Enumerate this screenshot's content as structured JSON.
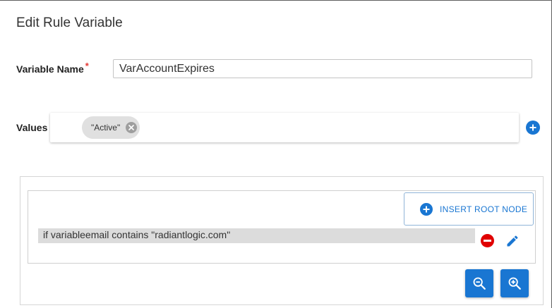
{
  "dialog": {
    "title": "Edit Rule Variable"
  },
  "variable": {
    "label": "Variable Name",
    "required_marker": "*",
    "value": "VarAccountExpires"
  },
  "values": {
    "label": "Values",
    "chips": [
      "\"Active\""
    ]
  },
  "rule_tree": {
    "insert_root_label": "INSERT ROOT NODE",
    "nodes": [
      "if variableemail contains \"radiantlogic.com\""
    ]
  },
  "icons": {
    "chip_remove": "close-circle-icon",
    "add_value": "plus-circle-icon",
    "insert_root": "plus-circle-icon",
    "remove_node": "minus-circle-icon",
    "edit_node": "pencil-icon",
    "zoom_out": "zoom-out-icon",
    "zoom_in": "zoom-in-icon"
  },
  "colors": {
    "accent": "#1976d2",
    "danger": "#e00000",
    "required": "#e53935",
    "chip_bg": "#e0e0e0",
    "node_bg": "#dcdcdc"
  }
}
